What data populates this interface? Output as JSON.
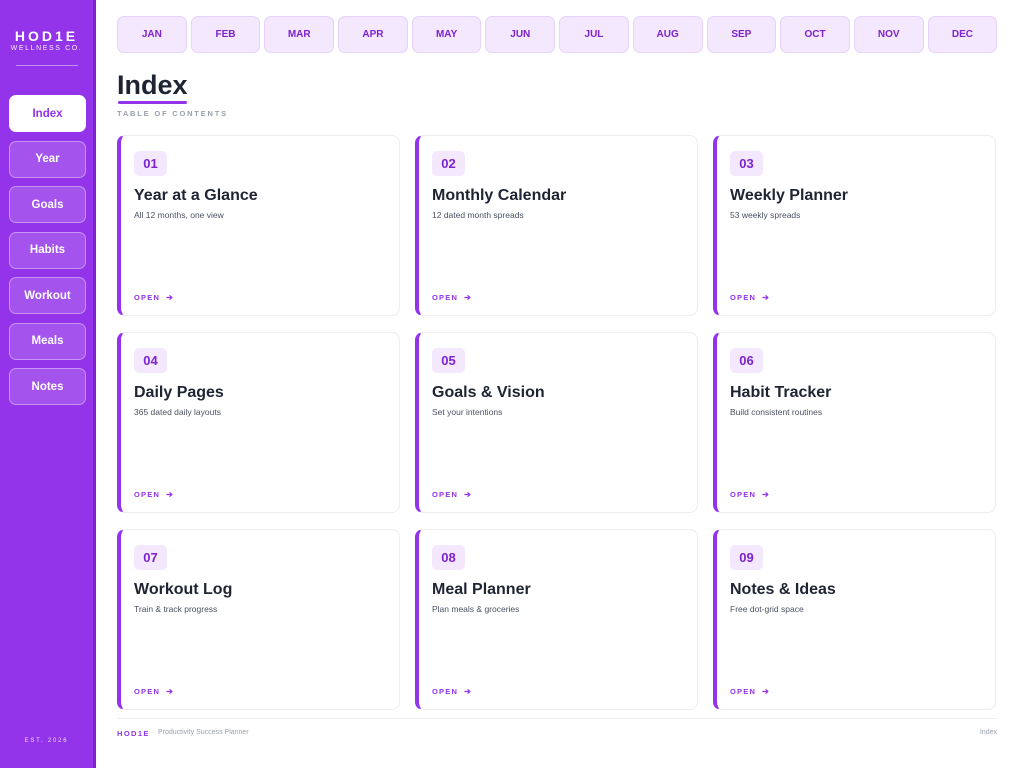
{
  "brand": {
    "name": "HOD1E",
    "sub": "WELLNESS CO.",
    "footer": "EST. 2026"
  },
  "nav": [
    {
      "label": "Index",
      "active": true
    },
    {
      "label": "Year"
    },
    {
      "label": "Goals"
    },
    {
      "label": "Habits"
    },
    {
      "label": "Workout"
    },
    {
      "label": "Meals"
    },
    {
      "label": "Notes"
    }
  ],
  "months": [
    "JAN",
    "FEB",
    "MAR",
    "APR",
    "MAY",
    "JUN",
    "JUL",
    "AUG",
    "SEP",
    "OCT",
    "NOV",
    "DEC"
  ],
  "page": {
    "title": "Index",
    "subtitle": "TABLE OF CONTENTS"
  },
  "cards": [
    {
      "num": "01",
      "title": "Year at a Glance",
      "desc": "All 12 months, one view",
      "open": "OPEN"
    },
    {
      "num": "02",
      "title": "Monthly Calendar",
      "desc": "12 dated month spreads",
      "open": "OPEN"
    },
    {
      "num": "03",
      "title": "Weekly Planner",
      "desc": "53 weekly spreads",
      "open": "OPEN"
    },
    {
      "num": "04",
      "title": "Daily Pages",
      "desc": "365 dated daily layouts",
      "open": "OPEN"
    },
    {
      "num": "05",
      "title": "Goals & Vision",
      "desc": "Set your intentions",
      "open": "OPEN"
    },
    {
      "num": "06",
      "title": "Habit Tracker",
      "desc": "Build consistent routines",
      "open": "OPEN"
    },
    {
      "num": "07",
      "title": "Workout Log",
      "desc": "Train & track progress",
      "open": "OPEN"
    },
    {
      "num": "08",
      "title": "Meal Planner",
      "desc": "Plan meals & groceries",
      "open": "OPEN"
    },
    {
      "num": "09",
      "title": "Notes & Ideas",
      "desc": "Free dot-grid space",
      "open": "OPEN"
    }
  ],
  "footer": {
    "brand": "HOD1E",
    "separator": "·",
    "text": "Productivity Success Planner",
    "right": "Index"
  },
  "colors": {
    "accent": "#9333ea",
    "accent_soft": "#f3e8fd",
    "text": "#1f2433"
  }
}
